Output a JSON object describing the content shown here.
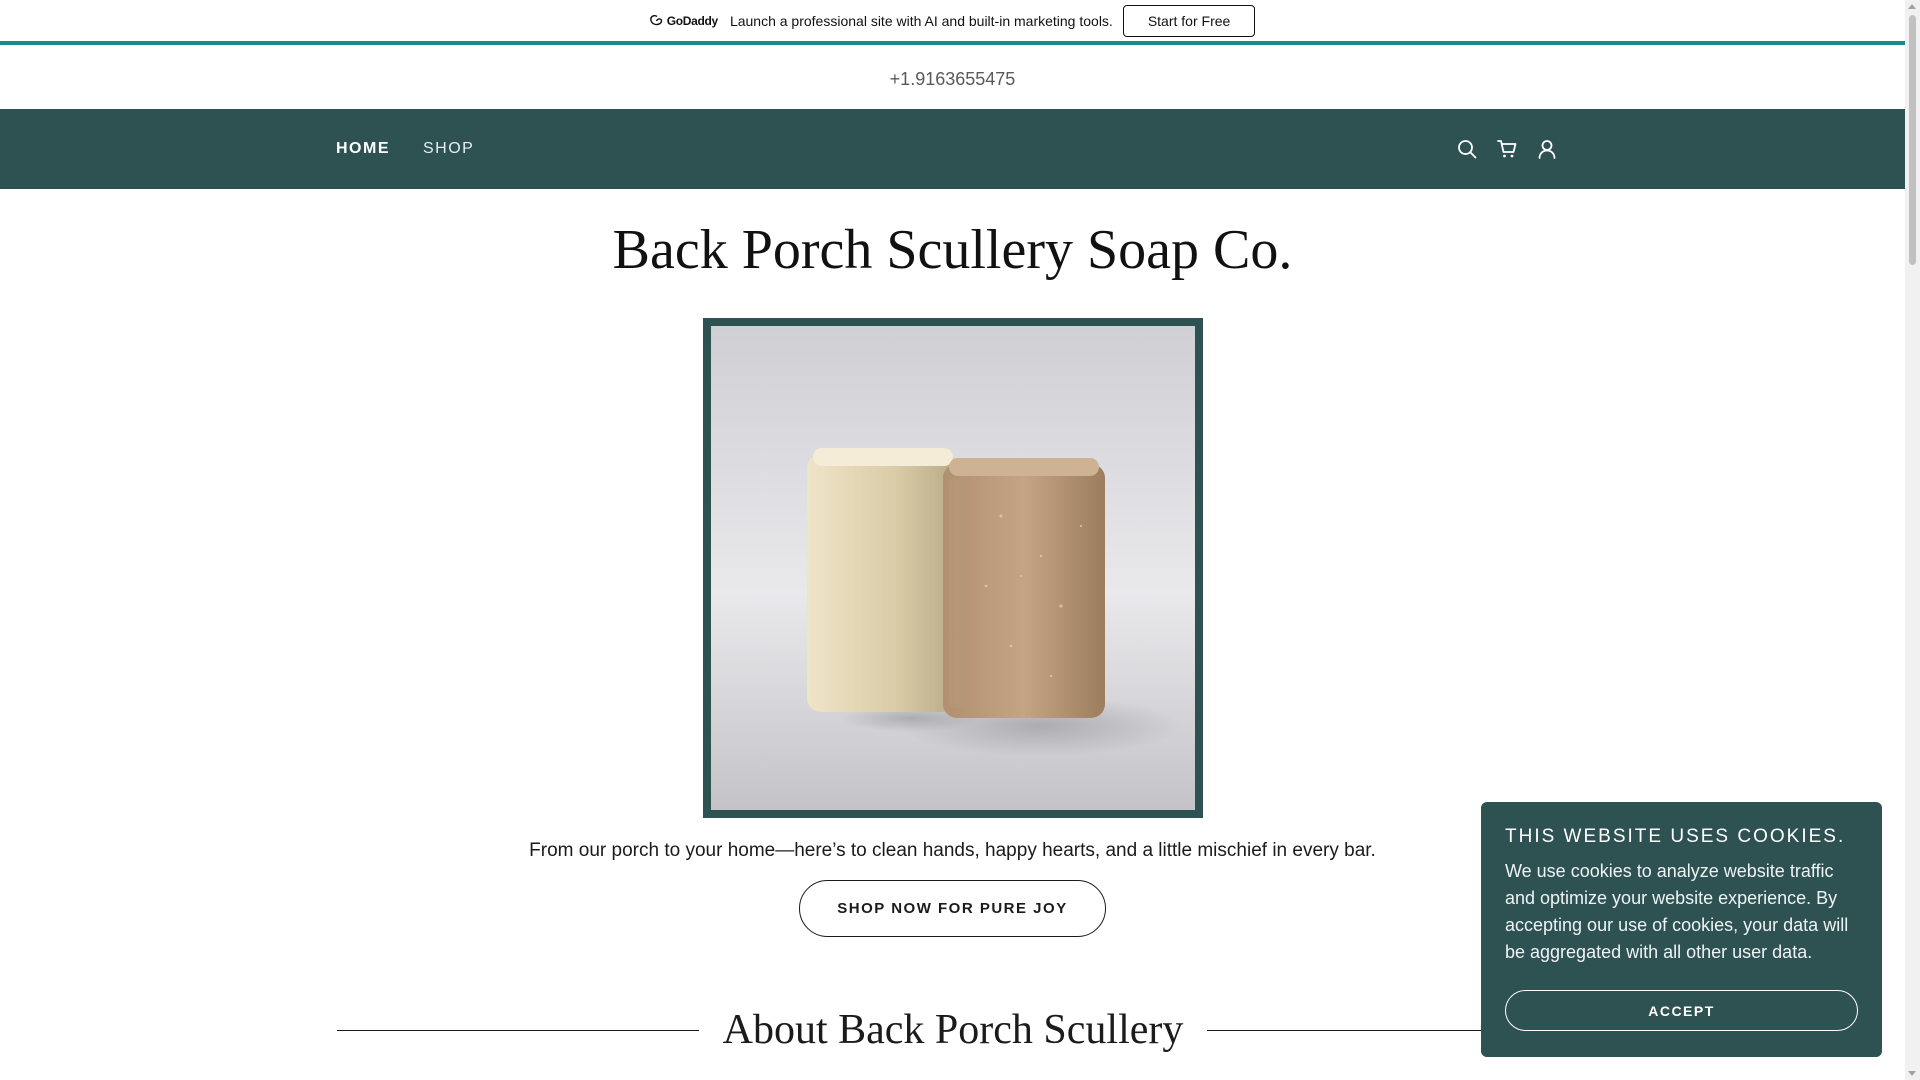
{
  "promo": {
    "logo_text": "GoDaddy",
    "text": "Launch a professional site with AI and built-in marketing tools.",
    "button_label": "Start for Free"
  },
  "header": {
    "phone": "+1.9163655475"
  },
  "nav": {
    "items": [
      {
        "label": "HOME",
        "active": true
      },
      {
        "label": "SHOP",
        "active": false
      }
    ],
    "icons": [
      "search-icon",
      "cart-icon",
      "account-icon"
    ]
  },
  "hero": {
    "title": "Back Porch Scullery Soap Co.",
    "tagline": "From our porch to your home—here’s to clean hands, happy hearts, and a little mischief in every bar.",
    "cta_label": "SHOP NOW FOR PURE JOY"
  },
  "about": {
    "title": "About Back Porch Scullery"
  },
  "cookie_banner": {
    "title": "THIS WEBSITE USES COOKIES.",
    "body": "We use cookies to analyze website traffic and optimize your website experience. By accepting our use of cookies, your data will be aggregated with all other user data.",
    "accept_label": "ACCEPT"
  },
  "colors": {
    "brand": "#2e5151",
    "promo_accent": "#1b8a8b"
  }
}
